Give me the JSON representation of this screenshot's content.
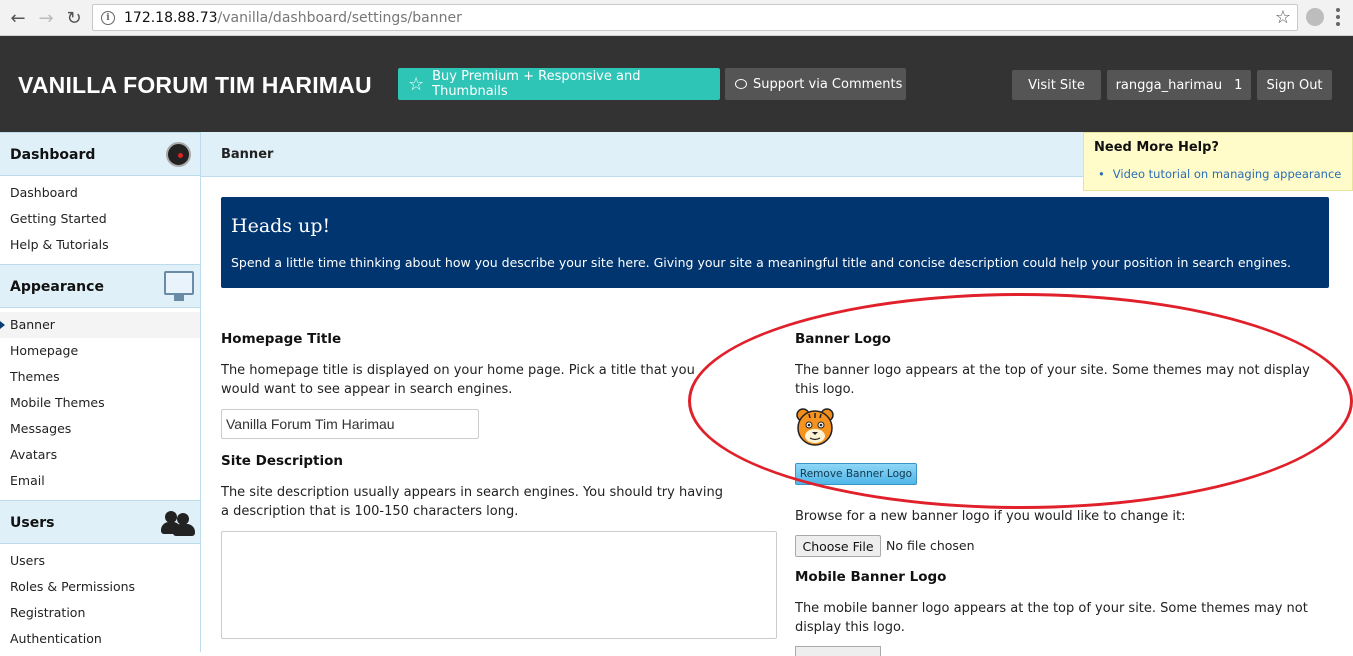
{
  "browser": {
    "url_host": "172.18.88.73",
    "url_path": "/vanilla/dashboard/settings/banner"
  },
  "header": {
    "site_title": "VANILLA FORUM TIM HARIMAU",
    "premium_label": "Buy Premium + Responsive and Thumbnails",
    "support_label": "Support via Comments",
    "visit_site_label": "Visit Site",
    "username": "rangga_harimau",
    "notification_count": "1",
    "sign_out_label": "Sign Out"
  },
  "sidebar": {
    "sections": [
      {
        "title": "Dashboard",
        "items": [
          "Dashboard",
          "Getting Started",
          "Help & Tutorials"
        ]
      },
      {
        "title": "Appearance",
        "items": [
          "Banner",
          "Homepage",
          "Themes",
          "Mobile Themes",
          "Messages",
          "Avatars",
          "Email"
        ]
      },
      {
        "title": "Users",
        "items": [
          "Users",
          "Roles & Permissions",
          "Registration",
          "Authentication"
        ]
      }
    ],
    "active_item": "Banner"
  },
  "page": {
    "breadcrumb": "Banner",
    "help_title": "Need More Help?",
    "help_link": "Video tutorial on managing appearance",
    "heads_up_title": "Heads up!",
    "heads_up_text": "Spend a little time thinking about how you describe your site here. Giving your site a meaningful title and concise description could help your position in search engines.",
    "homepage_title_label": "Homepage Title",
    "homepage_title_desc_1": "The homepage title is displayed on your home page. Pick a title that you",
    "homepage_title_desc_2": "would want to see appear in search engines.",
    "homepage_title_value": "Vanilla Forum Tim Harimau",
    "site_desc_label": "Site Description",
    "site_desc_desc_1": "The site description usually appears in search engines. You should try having",
    "site_desc_desc_2": "a description that is 100-150 characters long.",
    "banner_logo_label": "Banner Logo",
    "banner_logo_desc_1": "The banner logo appears at the top of your site. Some themes may not display",
    "banner_logo_desc_2": "this logo.",
    "remove_banner_label": "Remove Banner Logo",
    "browse_text": "Browse for a new banner logo if you would like to change it:",
    "choose_file_label": "Choose File",
    "no_file_text": "No file chosen",
    "mobile_logo_label": "Mobile Banner Logo",
    "mobile_logo_desc_1": "The mobile banner logo appears at the top of your site. Some themes may not",
    "mobile_logo_desc_2": "display this logo."
  },
  "colors": {
    "header_bg": "#333333",
    "premium_button": "#2ec4b6",
    "heads_up_bg": "#003570",
    "sidebar_head_bg": "#dff0f8",
    "help_box_bg": "#fffcc9",
    "annotation": "#e0202a"
  },
  "icons": [
    "back-arrow-icon",
    "forward-arrow-icon",
    "reload-icon",
    "info-icon",
    "bookmark-star-icon",
    "star-icon",
    "comment-bubble-icon",
    "dashboard-gauge-icon",
    "monitor-icon",
    "users-icon",
    "tiger-logo"
  ]
}
